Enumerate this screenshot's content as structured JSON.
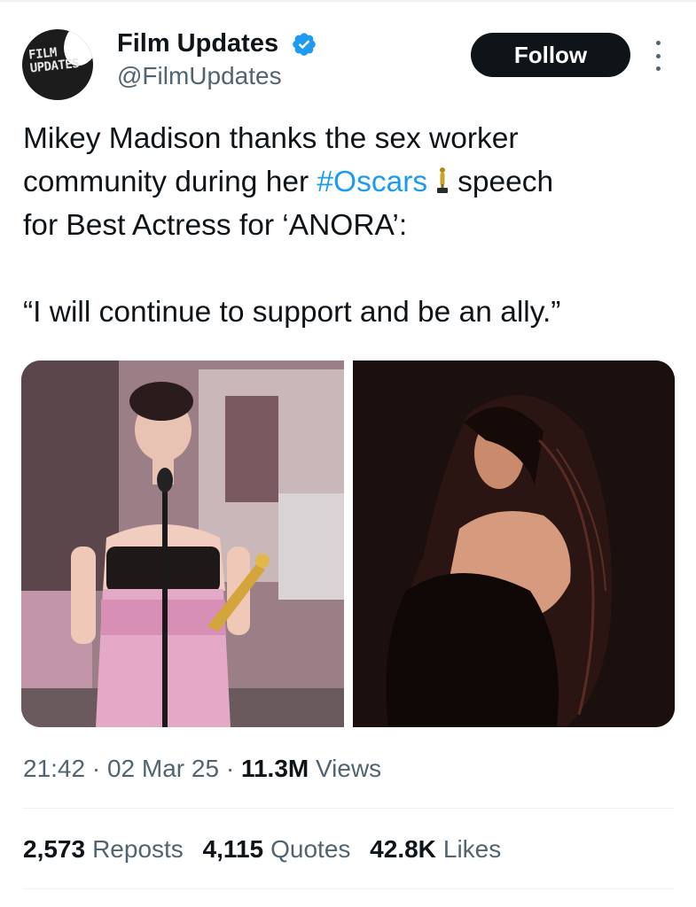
{
  "author": {
    "avatar_text": "FILM UPDATES",
    "name": "Film Updates",
    "handle": "@FilmUpdates",
    "verified": true
  },
  "actions": {
    "follow_label": "Follow",
    "more_icon": "more-vertical-icon"
  },
  "tweet": {
    "line1": "Mikey Madison thanks the sex worker",
    "line2_prefix": "community during her ",
    "hashtag": "#Oscars",
    "line2_suffix": "speech",
    "line3": "for Best Actress for ‘ANORA’:",
    "quote": "“I will continue to support and be an ally.”",
    "emoji": "oscar-trophy-icon"
  },
  "media": {
    "left_photo": "photo-oscars-speech",
    "right_photo": "photo-portrait"
  },
  "meta": {
    "time": "21:42",
    "separator": "·",
    "date": "02 Mar 25",
    "views_count": "11.3M",
    "views_label": "Views"
  },
  "stats": {
    "reposts_count": "2,573",
    "reposts_label": "Reposts",
    "quotes_count": "4,115",
    "quotes_label": "Quotes",
    "likes_count": "42.8K",
    "likes_label": "Likes"
  },
  "colors": {
    "accent": "#1d9bf0",
    "text": "#0f1419",
    "secondary": "#536471",
    "button": "#0f1419"
  }
}
